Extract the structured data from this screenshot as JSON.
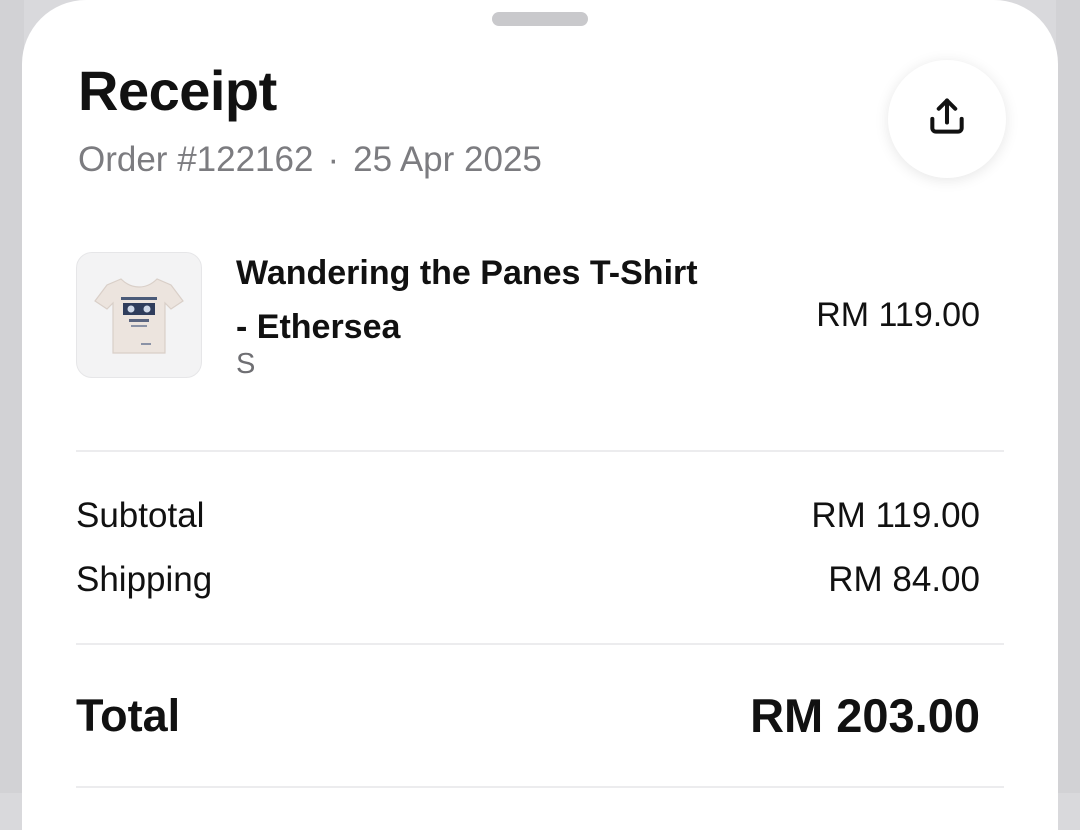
{
  "sheet": {
    "title": "Receipt",
    "order_number": "Order #122162",
    "separator": "·",
    "order_date": "25 Apr 2025",
    "share_icon": "share-upload-icon"
  },
  "item": {
    "name_line1": "Wandering the Panes T-Shirt",
    "name_line2": "- Ethersea",
    "variant": "S",
    "price": "RM 119.00"
  },
  "summary": {
    "subtotal_label": "Subtotal",
    "subtotal_value": "RM 119.00",
    "shipping_label": "Shipping",
    "shipping_value": "RM 84.00",
    "total_label": "Total",
    "total_value": "RM 203.00"
  },
  "colors": {
    "text_primary": "#111111",
    "text_secondary": "#7c7c80",
    "sheet_background": "#ffffff",
    "backdrop": "#d9d9dc"
  }
}
